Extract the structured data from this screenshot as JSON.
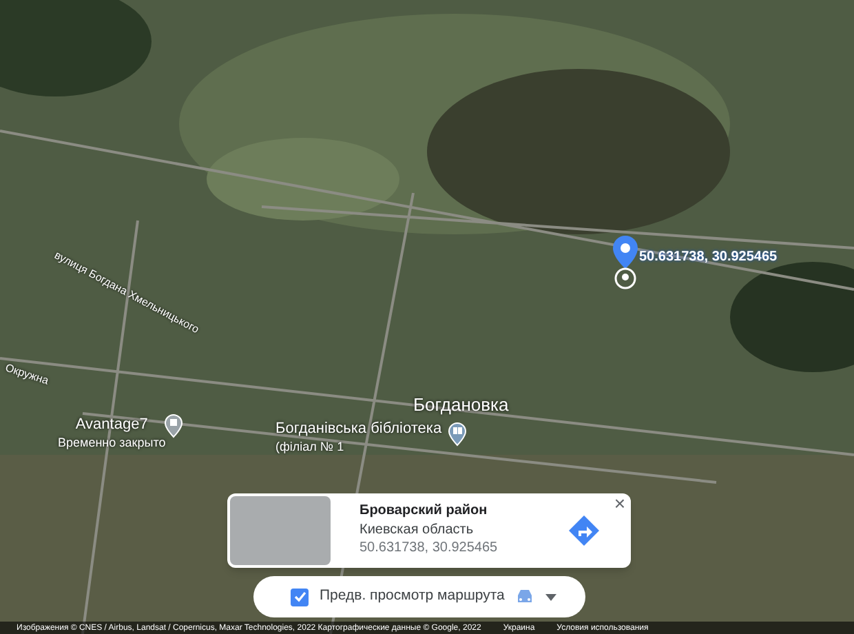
{
  "map_labels": [
    {
      "kind": "street",
      "text": "вулиця Богдана Хмельницького"
    },
    {
      "kind": "street",
      "text": "Окружна"
    },
    {
      "kind": "place",
      "text": "Avantage7",
      "sub": "Временно закрыто"
    },
    {
      "kind": "town",
      "text": "Богдановка"
    },
    {
      "kind": "place",
      "text": "Богданівська бібліотека",
      "sub": "(філіал № 1"
    }
  ],
  "pin": {
    "coords": "50.631738, 30.925465"
  },
  "info_card": {
    "title": "Броварский район",
    "region": "Киевская область",
    "coords": "50.631738, 30.925465",
    "close": "×"
  },
  "route_preview": {
    "label": "Предв. просмотр маршрута",
    "checked": true
  },
  "attribution": [
    "Изображения © CNES / Airbus, Landsat / Copernicus, Maxar Technologies, 2022 Картографические данные © Google, 2022",
    "Украина",
    "Условия использования"
  ]
}
